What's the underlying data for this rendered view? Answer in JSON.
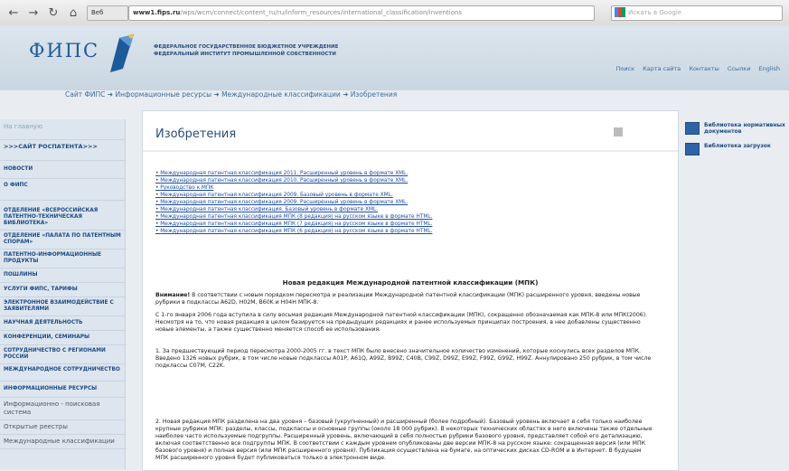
{
  "browser": {
    "tab_label": "Веб",
    "url_host": "www1.fips.ru",
    "url_path": "/wps/wcm/connect/content_ru/ru/inform_resources/international_classification/inventions",
    "search_placeholder": "Искать в Google"
  },
  "header": {
    "logo": "ФИПС",
    "org_line1": "ФЕДЕРАЛЬНОЕ ГОСУДАРСТВЕННОЕ БЮДЖЕТНОЕ УЧРЕЖДЕНИЕ",
    "org_line2": "ФЕДЕРАЛЬНЫЙ ИНСТИТУТ ПРОМЫШЛЕННОЙ СОБСТВЕННОСТИ",
    "menu": [
      "Поиск",
      "Карта сайта",
      "Контакты",
      "Ссылки",
      "English"
    ]
  },
  "breadcrumb": "Сайт ФИПС  ➜  Информационные ресурсы  ➜  Международные классификации  ➜  Изобретения",
  "sidebar": {
    "items": [
      "На главную",
      ">>>САЙТ РОСПАТЕНТА>>>",
      "НОВОСТИ",
      "О ФИПС",
      "ОТДЕЛЕНИЕ «ВСЕРОССИЙСКАЯ ПАТЕНТНО-ТЕХНИЧЕСКАЯ БИБЛИОТЕКА»",
      "ОТДЕЛЕНИЕ «ПАЛАТА ПО ПАТЕНТНЫМ СПОРАМ»",
      "ПАТЕНТНО-ИНФОРМАЦИОННЫЕ ПРОДУКТЫ",
      "ПОШЛИНЫ",
      "УСЛУГИ ФИПС, ТАРИФЫ",
      "ЭЛЕКТРОННОЕ ВЗАИМОДЕЙСТВИЕ С ЗАЯВИТЕЛЯМИ",
      "НАУЧНАЯ ДЕЯТЕЛЬНОСТЬ",
      "КОНФЕРЕНЦИИ, СЕМИНАРЫ",
      "СОТРУДНИЧЕСТВО С РЕГИОНАМИ РОССИИ",
      "МЕЖДУНАРОДНОЕ СОТРУДНИЧЕСТВО",
      "ИНФОРМАЦИОННЫЕ РЕСУРСЫ",
      "Информационно - поисковая система",
      "Открытые реестры",
      "Международные классификации"
    ]
  },
  "content": {
    "title": "Изобретения",
    "links": [
      "Международная патентная классификация 2011. Расширенный уровень в формате XML.",
      "Международная патентная классификация 2010. Расширенный уровень в формате XML.",
      "Руководство к МПК",
      "Международная патентная классификация 2009. Базовый уровень в формате XML.",
      "Международная патентная классификация 2009. Расширенный уровень в формате XML.",
      "Международная патентная классификация. Базовый уровень в формате XML.",
      "Международная патентная классификация МПК (8 редакция) на русском языке в формате HTML.",
      "Международная патентная классификация МПК (7 редакция) на русском языке в формате HTML.",
      "Международная патентная классификация МПК (6 редакция) на русском языке в формате HTML."
    ],
    "block_title": "Новая редакция Международной патентной классификации (МПК)",
    "note_label": "Внимание!",
    "note_text": " В соответствии с новым порядком пересмотра и реализации Международной патентной классификации (МПК) расширенного уровня, введены новые рубрики в подклассы A62D, H02M, B60K и H04H МПК-8.",
    "p1": "С 1-го января 2006 года вступила в силу восьмая редакция Международной патентной классификации (МПК), сокращенно обозначаемая как МПК-8 или МПК(2006). Несмотря на то, что новая редакция в целом базируется на предыдущих редакциях и ранее используемых принципах построения, в нее добавлены существенно новые элементы, а также существенно меняется способ ее использования.",
    "p2": "1. За предшествующий период пересмотра 2000-2005 гг. в текст МПК было внесено значительное количество изменений, которые коснулись всех разделов МПК. Введено 1326 новых рубрик, в том числе новые подклассы A01P, A61Q, A99Z, B99Z, C40B, C99Z, D99Z, E99Z, F99Z, G99Z, H99Z. Аннулировано 250 рубрик, в том числе подклассы C07M, C22K.",
    "p3": "2. Новая редакция МПК разделена на два уровня – базовый (укрупненный) и расширенный (более подробный). Базовый уровень включает в себя только наиболее крупные рубрики МПК: разделы, классы, подклассы и основные группы (около 18 000 рубрик). В некоторых технических областях в него включены также отдельные наиболее часто используемые подгруппы. Расширенный уровень, включающий в себя полностью рубрики базового уровня, представляет собой его детализацию, включая соответственно все подгруппы МПК. В соответствии с каждым уровнем опубликованы две версии МПК-8 на русском языке: сокращенная версия (или МПК базового уровня) и полная версия (или МПК расширенного уровня). Публикация осуществлена на бумаге, на оптических дисках CD-ROM и в Интернет. В будущем МПК расширенного уровня будет публиковаться только в электронном виде."
  },
  "right": {
    "items": [
      "Библиотека нормативных документов",
      "Библиотека загрузок"
    ]
  }
}
